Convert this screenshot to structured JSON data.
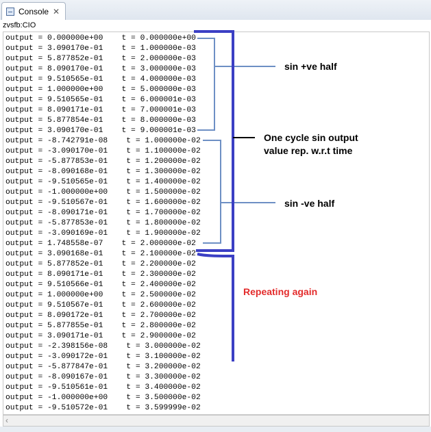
{
  "tab": {
    "label": "Console",
    "icon": "console-icon"
  },
  "path": "zvsfb:CIO",
  "console_lines": [
    "output = 0.000000e+00    t = 0.000000e+00",
    "output = 3.090170e-01    t = 1.000000e-03",
    "output = 5.877852e-01    t = 2.000000e-03",
    "output = 8.090170e-01    t = 3.000000e-03",
    "output = 9.510565e-01    t = 4.000000e-03",
    "output = 1.000000e+00    t = 5.000000e-03",
    "output = 9.510565e-01    t = 6.000001e-03",
    "output = 8.090171e-01    t = 7.000001e-03",
    "output = 5.877854e-01    t = 8.000000e-03",
    "output = 3.090170e-01    t = 9.000001e-03",
    "output = -8.742791e-08    t = 1.000000e-02",
    "output = -3.090170e-01    t = 1.100000e-02",
    "output = -5.877853e-01    t = 1.200000e-02",
    "output = -8.090168e-01    t = 1.300000e-02",
    "output = -9.510565e-01    t = 1.400000e-02",
    "output = -1.000000e+00    t = 1.500000e-02",
    "output = -9.510567e-01    t = 1.600000e-02",
    "output = -8.090171e-01    t = 1.700000e-02",
    "output = -5.877853e-01    t = 1.800000e-02",
    "output = -3.090169e-01    t = 1.900000e-02",
    "output = 1.748558e-07    t = 2.000000e-02",
    "output = 3.090168e-01    t = 2.100000e-02",
    "output = 5.877852e-01    t = 2.200000e-02",
    "output = 8.090171e-01    t = 2.300000e-02",
    "output = 9.510566e-01    t = 2.400000e-02",
    "output = 1.000000e+00    t = 2.500000e-02",
    "output = 9.510567e-01    t = 2.600000e-02",
    "output = 8.090172e-01    t = 2.700000e-02",
    "output = 5.877855e-01    t = 2.800000e-02",
    "output = 3.090171e-01    t = 2.900000e-02",
    "output = -2.398156e-08    t = 3.000000e-02",
    "output = -3.090172e-01    t = 3.100000e-02",
    "output = -5.877847e-01    t = 3.200000e-02",
    "output = -8.090167e-01    t = 3.300000e-02",
    "output = -9.510561e-01    t = 3.400000e-02",
    "output = -1.000000e+00    t = 3.500000e-02",
    "output = -9.510572e-01    t = 3.599999e-02"
  ],
  "annotations": {
    "pos_half": "sin +ve half",
    "cycle_line1": "One cycle sin output",
    "cycle_line2": "value rep. w.r.t time",
    "neg_half": "sin -ve half",
    "repeating": "Repeating again"
  },
  "colors": {
    "bracket_dark": "#3b3fc4",
    "bracket_light": "#6d8fc4",
    "annotation_red": "#e32b2b"
  }
}
